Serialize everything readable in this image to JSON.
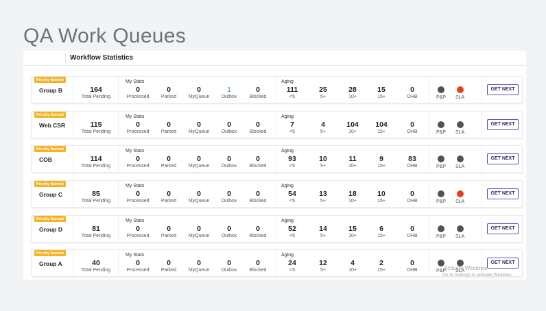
{
  "page": {
    "title": "QA Work Queues"
  },
  "header": {
    "workflow_statistics": "Workflow Statistics"
  },
  "labels": {
    "total_pending": "Total Pending",
    "my_stats": "My Stats",
    "processed": "Processed",
    "parked": "Parked",
    "myqueue": "MyQueue",
    "outbox": "Outbox",
    "blocked": "Blocked",
    "aging": "Aging",
    "lt5": "<5",
    "gt5": "5+",
    "gt10": "10+",
    "gt15": "15+",
    "ohb": "OHB",
    "pp": "P&P",
    "sla": "SLA",
    "get_next": "GET NEXT"
  },
  "colors": {
    "status_gray": "#4d5552",
    "status_red": "#e8401c",
    "badge": "#f2b424",
    "button_border": "#5a4fb0"
  },
  "queues": [
    {
      "badge": "Priority Normal",
      "name": "Group B",
      "total_pending": "164",
      "processed": "0",
      "parked": "0",
      "myqueue": "0",
      "outbox": "1",
      "blocked": "0",
      "aging_lt5": "111",
      "aging_5": "25",
      "aging_10": "28",
      "aging_15": "15",
      "ohb": "0",
      "pp_status": "gray",
      "sla_status": "red"
    },
    {
      "badge": "Priority Normal",
      "name": "Web CSR",
      "total_pending": "115",
      "processed": "0",
      "parked": "0",
      "myqueue": "0",
      "outbox": "0",
      "blocked": "0",
      "aging_lt5": "7",
      "aging_5": "4",
      "aging_10": "104",
      "aging_15": "104",
      "ohb": "0",
      "pp_status": "gray",
      "sla_status": "gray"
    },
    {
      "badge": "Priority Normal",
      "name": "COB",
      "total_pending": "114",
      "processed": "0",
      "parked": "0",
      "myqueue": "0",
      "outbox": "0",
      "blocked": "0",
      "aging_lt5": "93",
      "aging_5": "10",
      "aging_10": "11",
      "aging_15": "9",
      "ohb": "83",
      "pp_status": "gray",
      "sla_status": "gray"
    },
    {
      "badge": "Priority Normal",
      "name": "Group C",
      "total_pending": "85",
      "processed": "0",
      "parked": "0",
      "myqueue": "0",
      "outbox": "0",
      "blocked": "0",
      "aging_lt5": "54",
      "aging_5": "13",
      "aging_10": "18",
      "aging_15": "10",
      "ohb": "0",
      "pp_status": "gray",
      "sla_status": "red"
    },
    {
      "badge": "Priority Normal",
      "name": "Group D",
      "total_pending": "81",
      "processed": "0",
      "parked": "0",
      "myqueue": "0",
      "outbox": "0",
      "blocked": "0",
      "aging_lt5": "52",
      "aging_5": "14",
      "aging_10": "15",
      "aging_15": "6",
      "ohb": "0",
      "pp_status": "gray",
      "sla_status": "gray"
    },
    {
      "badge": "Priority Normal",
      "name": "Group A",
      "total_pending": "40",
      "processed": "0",
      "parked": "0",
      "myqueue": "0",
      "outbox": "0",
      "blocked": "0",
      "aging_lt5": "24",
      "aging_5": "12",
      "aging_10": "4",
      "aging_15": "2",
      "ohb": "0",
      "pp_status": "gray",
      "sla_status": "gray"
    }
  ],
  "watermark": {
    "line1": "Activate Windows",
    "line2": "Go to Settings to activate Windows."
  }
}
